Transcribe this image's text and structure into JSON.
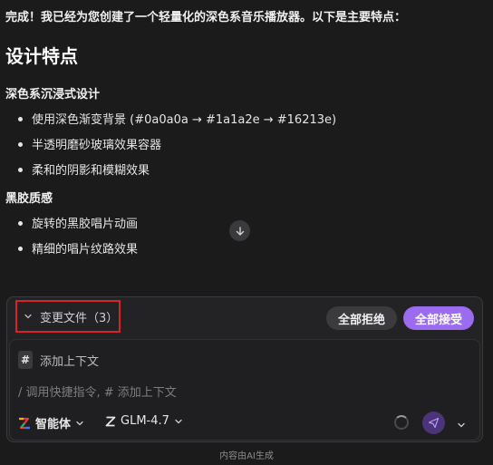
{
  "message": {
    "intro": "完成！我已经为您创建了一个轻量化的深色系音乐播放器。以下是主要特点：",
    "heading": "设计特点",
    "sections": [
      {
        "title": "深色系沉浸式设计",
        "items": [
          "使用深色渐变背景 (#0a0a0a → #1a1a2e → #16213e)",
          "半透明磨砂玻璃效果容器",
          "柔和的阴影和模糊效果"
        ]
      },
      {
        "title": "黑胶质感",
        "items": [
          "旋转的黑胶唱片动画",
          "精细的唱片纹路效果"
        ]
      }
    ]
  },
  "changes": {
    "label": "变更文件（3）",
    "reject_label": "全部拒绝",
    "accept_label": "全部接受"
  },
  "input": {
    "context_icon": "#",
    "context_label": "添加上下文",
    "placeholder": "/ 调用快捷指令, # 添加上下文",
    "agent_label": "智能体",
    "model_label": "GLM-4.7"
  },
  "footer": {
    "note": "内容由AI生成"
  },
  "colors": {
    "accent": "#9b6cf0",
    "highlight_border": "#d9232b",
    "background": "#1b1b1c"
  }
}
